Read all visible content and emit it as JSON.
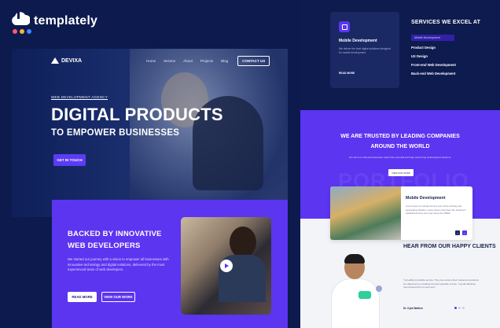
{
  "brand": {
    "name": "templately",
    "dot_colors": [
      "#ff5b6b",
      "#ffb23e",
      "#3d8bff"
    ]
  },
  "left_mock": {
    "nav": {
      "logo": "DEVIXA",
      "links": [
        "Home",
        "Service",
        "About",
        "Projects",
        "Blog"
      ],
      "cta": "CONTACT US"
    },
    "hero": {
      "badge": "WEB DEVELOPMENT AGENCY",
      "title": "DIGITAL PRODUCTS",
      "subtitle": "TO EMPOWER BUSINESSES",
      "button": "GET IN TOUCH"
    },
    "about": {
      "title_line1": "BACKED BY INNOVATIVE",
      "title_line2": "WEB DEVELOPERS",
      "paragraph": "We started our journey with a vision to empower all businesses with innovative technology and digital solutions, delivered by the most experienced team of web developers.",
      "read_more": "READ MORE",
      "view_work": "VIEW OUR WORK"
    }
  },
  "right_mock": {
    "service_card": {
      "title": "Mobile Development",
      "description": "We deliver the best digital solutions designed for mobile development.",
      "link": "READ MORE"
    },
    "services": {
      "heading": "SERVICES WE EXCEL AT",
      "selected": "Mobile Development",
      "items": [
        "Product Design",
        "UX Design",
        "Front-end Web Development",
        "Back-end Web Development"
      ]
    },
    "trusted": {
      "title_line1": "WE ARE TRUSTED BY LEADING COMPANIES",
      "title_line2": "AROUND THE WORLD",
      "paragraph": "Our aim is to help all businesses reach their potential with high performing technological solutions.",
      "button": "VIEW OUR WORK",
      "watermark": "PORTFOLIO"
    },
    "project_card": {
      "title": "Mobile Development",
      "description": "Lorem Ipsum is simply dummy text of the printing and typesetting industry. Lorem Ipsum has been the industry's standard dummy text ever since the 1500s."
    },
    "clients": {
      "heading": "HEAR FROM OUR HAPPY CLIENTS",
      "quote": "\"Incredibly incredible service. They can ensure their customers solutions are delivered by providing the best possible service. I would definitely recommend them to everyone.\"",
      "author": "Dr. Kyla Walters"
    }
  }
}
